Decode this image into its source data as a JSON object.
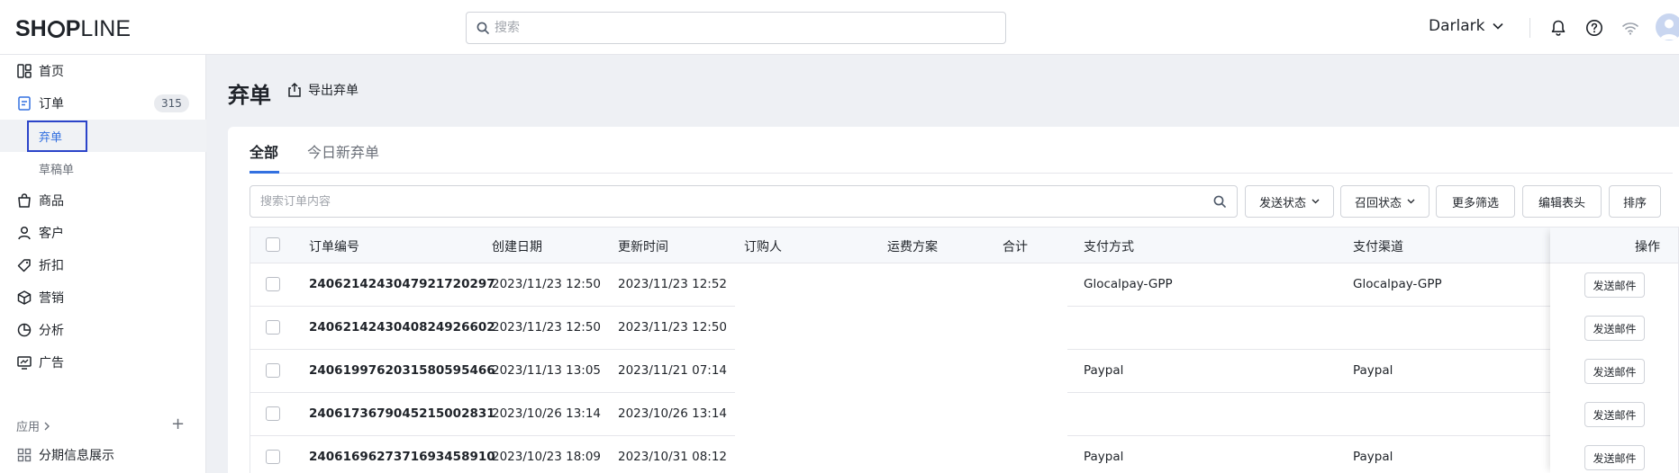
{
  "header": {
    "logo": "SHOPLINE",
    "search_placeholder": "搜索",
    "store_name": "Darlark"
  },
  "sidebar": {
    "items": [
      {
        "label": "首页",
        "icon": "dashboard-icon"
      },
      {
        "label": "订单",
        "icon": "order-icon",
        "badge": "315"
      },
      {
        "label": "商品",
        "icon": "bag-icon"
      },
      {
        "label": "客户",
        "icon": "person-icon"
      },
      {
        "label": "折扣",
        "icon": "tag-icon"
      },
      {
        "label": "营销",
        "icon": "cube-icon"
      },
      {
        "label": "分析",
        "icon": "pie-icon"
      },
      {
        "label": "广告",
        "icon": "monitor-icon"
      }
    ],
    "sub_items": [
      {
        "label": "弃单",
        "active": true
      },
      {
        "label": "草稿单",
        "active": false
      }
    ],
    "apps_section": "应用",
    "app_items": [
      {
        "label": "分期信息展示",
        "icon": "grid-icon"
      }
    ]
  },
  "page": {
    "title": "弃单",
    "export_label": "导出弃单"
  },
  "tabs": [
    {
      "label": "全部",
      "active": true
    },
    {
      "label": "今日新弃单",
      "active": false
    }
  ],
  "filters": {
    "search_placeholder": "搜索订单内容",
    "send_status": "发送状态",
    "recall_status": "召回状态",
    "more_filters": "更多筛选",
    "edit_columns": "编辑表头",
    "sort": "排序"
  },
  "table": {
    "columns": [
      "订单编号",
      "创建日期",
      "更新时间",
      "订购人",
      "运费方案",
      "合计",
      "支付方式",
      "支付渠道",
      "操作"
    ],
    "action_label": "发送邮件",
    "rows": [
      {
        "id": "2406214243047921720297",
        "created": "2023/11/23 12:50",
        "updated": "2023/11/23 12:52",
        "payment_method": "Glocalpay-GPP",
        "payment_channel": "Glocalpay-GPP"
      },
      {
        "id": "2406214243040824926602",
        "created": "2023/11/23 12:50",
        "updated": "2023/11/23 12:50",
        "payment_method": "",
        "payment_channel": ""
      },
      {
        "id": "2406199762031580595466",
        "created": "2023/11/13 13:05",
        "updated": "2023/11/21 07:14",
        "payment_method": "Paypal",
        "payment_channel": "Paypal"
      },
      {
        "id": "2406173679045215002831",
        "created": "2023/10/26 13:14",
        "updated": "2023/10/26 13:14",
        "payment_method": "",
        "payment_channel": ""
      },
      {
        "id": "2406169627371693458910",
        "created": "2023/10/23 18:09",
        "updated": "2023/10/31 08:12",
        "payment_method": "Paypal",
        "payment_channel": "Paypal"
      }
    ]
  }
}
